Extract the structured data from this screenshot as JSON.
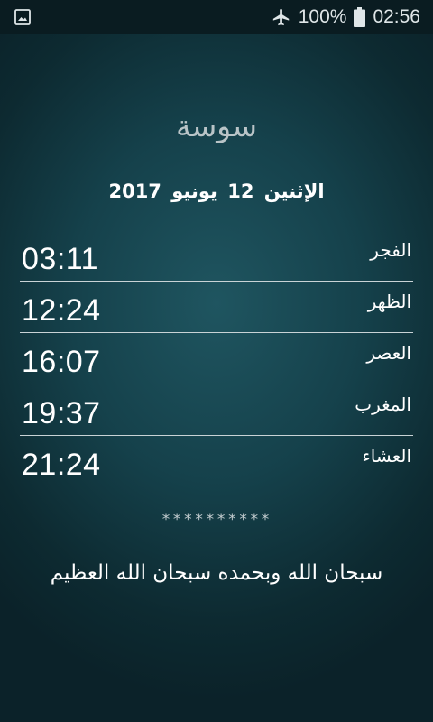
{
  "status_bar": {
    "battery": "100%",
    "time": "02:56",
    "icons": [
      "gallery-icon",
      "airplane-icon",
      "battery-icon"
    ]
  },
  "city": "سوسة",
  "date": "الإثنين 12 يونيو 2017",
  "prayers": [
    {
      "name": "الفجر",
      "time": "03:11"
    },
    {
      "name": "الظهر",
      "time": "12:24"
    },
    {
      "name": "العصر",
      "time": "16:07"
    },
    {
      "name": "المغرب",
      "time": "19:37"
    },
    {
      "name": "العشاء",
      "time": "21:24"
    }
  ],
  "separator": "**********",
  "dhikr": "سبحان الله وبحمده سبحان الله العظيم",
  "colors": {
    "status_bar_bg": "#0a1c21",
    "background_center": "#1f5560",
    "background_edge": "#0b2229",
    "text": "#ffffff",
    "city_text": "#b9c4c7",
    "divider": "#c9d3d6"
  }
}
